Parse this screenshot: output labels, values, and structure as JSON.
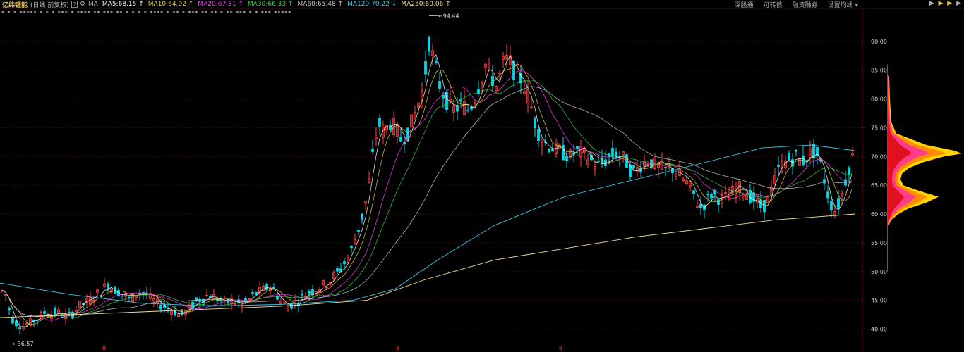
{
  "header": {
    "stock_name": "亿纬锂能",
    "period_label": "(日线 前复权)",
    "help_icon": "?",
    "gear_icon": "gear-icon",
    "ma_label": "MA",
    "ma_items": [
      {
        "text": "MA5:68.15",
        "arrow": "↑",
        "color": "#ffffff"
      },
      {
        "text": "MA10:64.92",
        "arrow": "↑",
        "color": "#e8d040"
      },
      {
        "text": "MA20:67.31",
        "arrow": "↑",
        "color": "#ff3cff"
      },
      {
        "text": "MA30:66.33",
        "arrow": "↑",
        "color": "#40d040"
      },
      {
        "text": "MA60:65.48",
        "arrow": "↑",
        "color": "#cccccc"
      },
      {
        "text": "MA120:70.22",
        "arrow": "↓",
        "color": "#40c8e8"
      },
      {
        "text": "MA250:60.06",
        "arrow": "↑",
        "color": "#f0e0a0"
      }
    ]
  },
  "toolbar": {
    "items": [
      "深股通",
      "可转债",
      "融资融券",
      "设置均线 ▾"
    ]
  },
  "corner_icons": [
    "▶",
    "▶",
    "▶",
    "▶"
  ],
  "colors": {
    "up": "#ff4040",
    "down": "#00d8e8",
    "grid": "#3a0a0a",
    "axis_text": "#ccc"
  },
  "chart_data": {
    "type": "candlestick",
    "y_ticks": [
      "90.00",
      "85.00",
      "80.00",
      "75.00",
      "70.00",
      "65.00",
      "60.00",
      "55.00",
      "50.00",
      "45.00",
      "40.00"
    ],
    "ylim": [
      37,
      95
    ],
    "max_label": "94.44",
    "min_label": "36.57",
    "marker_labels": [
      "8",
      "8",
      "8"
    ],
    "star_marks": "* * * ***** * * * *** * **** ** *** ** * * * * **** * ** * *** ** ** * ** *** * * *** *****",
    "price_path": [
      [
        0,
        47
      ],
      [
        8,
        46
      ],
      [
        16,
        42
      ],
      [
        24,
        41
      ],
      [
        32,
        40.5
      ],
      [
        40,
        41
      ],
      [
        48,
        41.5
      ],
      [
        56,
        42
      ],
      [
        64,
        43
      ],
      [
        72,
        42.5
      ],
      [
        80,
        43
      ],
      [
        88,
        42.5
      ],
      [
        96,
        42
      ],
      [
        104,
        43
      ],
      [
        112,
        44
      ],
      [
        120,
        44.5
      ],
      [
        128,
        45
      ],
      [
        136,
        46
      ],
      [
        144,
        46.5
      ],
      [
        152,
        48
      ],
      [
        160,
        47
      ],
      [
        168,
        46.5
      ],
      [
        176,
        46
      ],
      [
        184,
        45
      ],
      [
        192,
        46
      ],
      [
        200,
        46.5
      ],
      [
        208,
        46
      ],
      [
        216,
        45
      ],
      [
        224,
        44.5
      ],
      [
        232,
        44
      ],
      [
        240,
        43.5
      ],
      [
        248,
        43
      ],
      [
        256,
        42.5
      ],
      [
        264,
        43
      ],
      [
        272,
        44
      ],
      [
        280,
        45
      ],
      [
        288,
        45.5
      ],
      [
        296,
        46
      ],
      [
        304,
        45.5
      ],
      [
        312,
        45
      ],
      [
        320,
        44.5
      ],
      [
        328,
        45
      ],
      [
        336,
        44.5
      ],
      [
        344,
        44
      ],
      [
        352,
        45
      ],
      [
        360,
        46
      ],
      [
        368,
        46.5
      ],
      [
        376,
        47
      ],
      [
        384,
        47.5
      ],
      [
        392,
        46
      ],
      [
        400,
        44.5
      ],
      [
        408,
        44
      ],
      [
        416,
        44.5
      ],
      [
        424,
        45
      ],
      [
        432,
        46
      ],
      [
        440,
        46.5
      ],
      [
        448,
        47
      ],
      [
        456,
        47.5
      ],
      [
        464,
        48
      ],
      [
        472,
        49
      ],
      [
        480,
        50
      ],
      [
        488,
        51.5
      ],
      [
        496,
        53
      ],
      [
        504,
        56
      ],
      [
        512,
        59
      ],
      [
        520,
        63
      ],
      [
        528,
        70
      ],
      [
        536,
        76
      ],
      [
        544,
        74
      ],
      [
        552,
        76
      ],
      [
        560,
        75
      ],
      [
        568,
        73
      ],
      [
        576,
        74
      ],
      [
        584,
        76
      ],
      [
        592,
        79
      ],
      [
        600,
        82
      ],
      [
        608,
        90
      ],
      [
        616,
        86
      ],
      [
        624,
        82
      ],
      [
        632,
        80
      ],
      [
        640,
        78
      ],
      [
        648,
        78.5
      ],
      [
        656,
        79
      ],
      [
        664,
        78
      ],
      [
        672,
        80
      ],
      [
        680,
        83
      ],
      [
        688,
        86
      ],
      [
        696,
        84
      ],
      [
        704,
        82
      ],
      [
        712,
        86
      ],
      [
        720,
        87
      ],
      [
        728,
        85
      ],
      [
        736,
        84
      ],
      [
        744,
        82
      ],
      [
        752,
        79
      ],
      [
        760,
        75
      ],
      [
        768,
        73
      ],
      [
        776,
        72
      ],
      [
        784,
        71.5
      ],
      [
        792,
        71
      ],
      [
        800,
        70.5
      ],
      [
        808,
        70
      ],
      [
        816,
        71
      ],
      [
        824,
        70.5
      ],
      [
        832,
        70
      ],
      [
        840,
        69
      ],
      [
        848,
        68.5
      ],
      [
        856,
        69
      ],
      [
        864,
        70
      ],
      [
        872,
        70.5
      ],
      [
        880,
        70
      ],
      [
        888,
        69
      ],
      [
        896,
        67
      ],
      [
        904,
        68
      ],
      [
        912,
        69
      ],
      [
        920,
        69.5
      ],
      [
        928,
        68.5
      ],
      [
        936,
        68
      ],
      [
        944,
        67.5
      ],
      [
        952,
        68
      ],
      [
        960,
        67
      ],
      [
        968,
        66
      ],
      [
        976,
        65
      ],
      [
        984,
        63
      ],
      [
        992,
        61
      ],
      [
        1000,
        62
      ],
      [
        1008,
        63.5
      ],
      [
        1016,
        63
      ],
      [
        1024,
        62.5
      ],
      [
        1032,
        63
      ],
      [
        1040,
        64
      ],
      [
        1048,
        64.5
      ],
      [
        1056,
        64
      ],
      [
        1064,
        63
      ],
      [
        1072,
        62
      ],
      [
        1080,
        61
      ],
      [
        1088,
        62.5
      ],
      [
        1096,
        65
      ],
      [
        1104,
        68
      ],
      [
        1112,
        69
      ],
      [
        1120,
        69.5
      ],
      [
        1128,
        70
      ],
      [
        1136,
        69
      ],
      [
        1144,
        70
      ],
      [
        1152,
        71
      ],
      [
        1160,
        70
      ],
      [
        1168,
        66
      ],
      [
        1176,
        62
      ],
      [
        1184,
        60.5
      ],
      [
        1192,
        63
      ],
      [
        1200,
        67
      ],
      [
        1208,
        70
      ],
      [
        1212,
        71
      ]
    ],
    "ma_lines": [
      {
        "name": "MA5",
        "color": "#ffffff",
        "offset": 0,
        "smooth": 3
      },
      {
        "name": "MA10",
        "color": "#e8d040",
        "offset": 0,
        "smooth": 6
      },
      {
        "name": "MA20",
        "color": "#ff3cff",
        "offset": 0,
        "smooth": 12
      },
      {
        "name": "MA30",
        "color": "#40d040",
        "offset": 0,
        "smooth": 18
      },
      {
        "name": "MA60",
        "color": "#cccccc",
        "offset": 0,
        "smooth": 35
      }
    ],
    "ma120_path": [
      [
        0,
        48
      ],
      [
        100,
        46
      ],
      [
        200,
        44.5
      ],
      [
        300,
        44
      ],
      [
        400,
        44.3
      ],
      [
        500,
        45
      ],
      [
        560,
        47
      ],
      [
        620,
        52
      ],
      [
        700,
        58
      ],
      [
        800,
        63
      ],
      [
        900,
        66
      ],
      [
        1000,
        69
      ],
      [
        1080,
        71.5
      ],
      [
        1150,
        72
      ],
      [
        1212,
        71
      ]
    ],
    "ma250_path": [
      [
        0,
        42
      ],
      [
        200,
        43
      ],
      [
        400,
        44
      ],
      [
        520,
        45
      ],
      [
        600,
        48.5
      ],
      [
        700,
        52
      ],
      [
        800,
        54
      ],
      [
        900,
        56
      ],
      [
        1000,
        57.5
      ],
      [
        1100,
        59
      ],
      [
        1212,
        60
      ]
    ],
    "volume_profile": {
      "levels": [
        {
          "price": 84,
          "w": 2
        },
        {
          "price": 80,
          "w": 3
        },
        {
          "price": 76,
          "w": 5
        },
        {
          "price": 74,
          "w": 12
        },
        {
          "price": 72,
          "w": 55
        },
        {
          "price": 71,
          "w": 95
        },
        {
          "price": 70.5,
          "w": 105
        },
        {
          "price": 70,
          "w": 80
        },
        {
          "price": 69,
          "w": 50
        },
        {
          "price": 68,
          "w": 30
        },
        {
          "price": 67,
          "w": 20
        },
        {
          "price": 66,
          "w": 18
        },
        {
          "price": 65,
          "w": 22
        },
        {
          "price": 64,
          "w": 45
        },
        {
          "price": 63,
          "w": 72
        },
        {
          "price": 62,
          "w": 55
        },
        {
          "price": 61,
          "w": 30
        },
        {
          "price": 60,
          "w": 15
        },
        {
          "price": 59,
          "w": 5
        },
        {
          "price": 58,
          "w": 1
        }
      ]
    }
  }
}
